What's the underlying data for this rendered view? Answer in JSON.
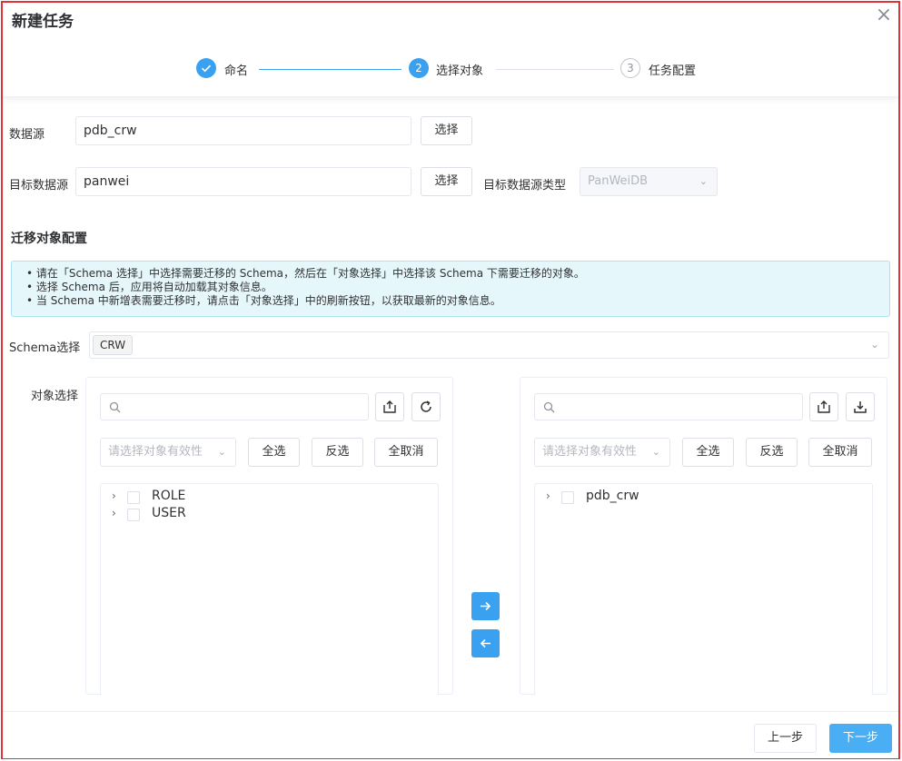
{
  "dialog": {
    "title": "新建任务",
    "close_icon": "×"
  },
  "steps": [
    {
      "number": "✓",
      "label": "命名",
      "state": "done"
    },
    {
      "number": "2",
      "label": "选择对象",
      "state": "active"
    },
    {
      "number": "3",
      "label": "任务配置",
      "state": "todo"
    }
  ],
  "form": {
    "source_label": "数据源",
    "source_value": "pdb_crw",
    "source_button": "选择",
    "target_label": "目标数据源",
    "target_value": "panwei",
    "target_button": "选择",
    "target_type_label": "目标数据源类型",
    "target_type_value": "PanWeiDB"
  },
  "section_title": "迁移对象配置",
  "notice": [
    "• 请在「Schema 选择」中选择需要迁移的 Schema，然后在「对象选择」中选择该 Schema 下需要迁移的对象。",
    "• 选择 Schema 后，应用将自动加载其对象信息。",
    "• 当 Schema 中新增表需要迁移时，请点击「对象选择」中的刷新按钮，以获取最新的对象信息。"
  ],
  "schema": {
    "label": "Schema选择",
    "selected_tag": "CRW"
  },
  "objects": {
    "label": "对象选择",
    "left": {
      "filter_placeholder": "请选择对象有效性",
      "select_all": "全选",
      "invert": "反选",
      "deselect_all": "全取消",
      "items": [
        "ROLE",
        "USER"
      ]
    },
    "right": {
      "filter_placeholder": "请选择对象有效性",
      "select_all": "全选",
      "invert": "反选",
      "deselect_all": "全取消",
      "items": [
        "pdb_crw"
      ]
    }
  },
  "footer": {
    "prev": "上一步",
    "next": "下一步"
  },
  "colors": {
    "accent": "#3aa1f0",
    "frame_border": "#e0323a",
    "notice_bg": "#e6f7fb"
  }
}
